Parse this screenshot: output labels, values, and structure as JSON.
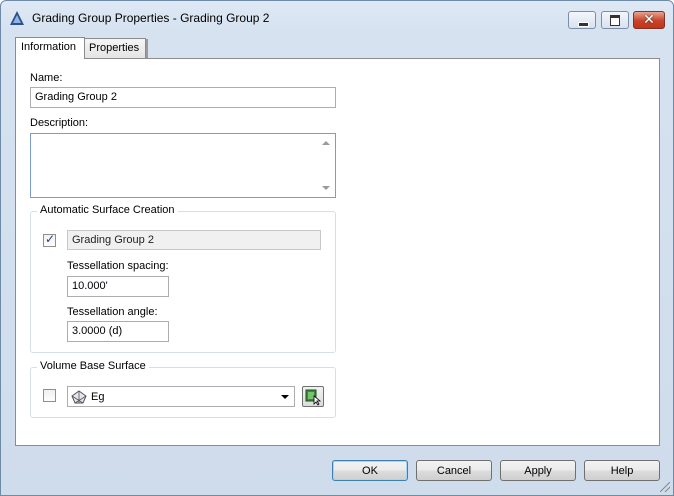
{
  "window": {
    "title": "Grading Group Properties - Grading Group 2",
    "close_glyph": "✕"
  },
  "tabs": [
    {
      "label": "Information",
      "active": true
    },
    {
      "label": "Properties",
      "active": false
    }
  ],
  "form": {
    "name_label": "Name:",
    "name_value": "Grading Group 2",
    "description_label": "Description:",
    "description_value": ""
  },
  "auto_surface": {
    "group_title": "Automatic Surface Creation",
    "checked": true,
    "surface_name": "Grading Group 2",
    "spacing_label": "Tessellation spacing:",
    "spacing_value": "10.000'",
    "angle_label": "Tessellation angle:",
    "angle_value": "3.0000 (d)"
  },
  "volume_base": {
    "group_title": "Volume Base Surface",
    "checked": false,
    "surface_selected": "Eg",
    "surface_icon": "tin-surface-icon"
  },
  "buttons": {
    "ok": "OK",
    "cancel": "Cancel",
    "apply": "Apply",
    "help": "Help"
  },
  "colors": {
    "title_bg": "#dfe9f5",
    "close_red": "#c7432a",
    "default_button_border": "#3c7fb1"
  }
}
